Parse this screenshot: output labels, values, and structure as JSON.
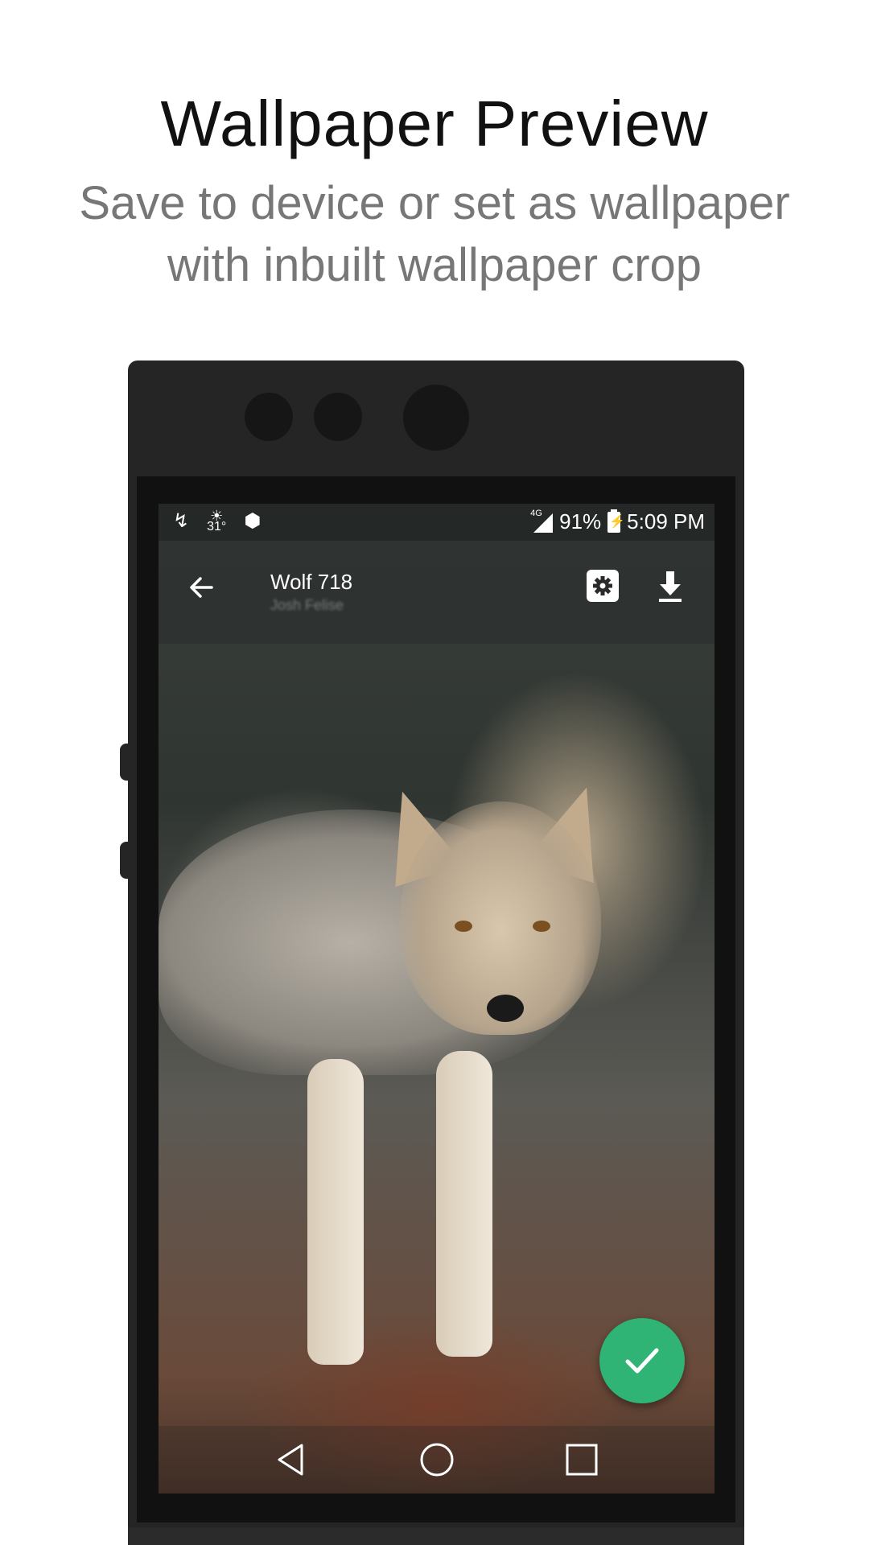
{
  "headline": "Wallpaper Preview",
  "subline": "Save to device or set as wallpaper with inbuilt wallpaper crop",
  "status_bar": {
    "temperature": "31°",
    "network": "4G",
    "battery": "91%",
    "time": "5:09 PM",
    "icons": [
      "usb-icon",
      "weather-icon",
      "android-debug-icon",
      "signal-icon",
      "battery-charging-icon"
    ]
  },
  "app_bar": {
    "title": "Wolf 718",
    "subtitle": "Josh Felise",
    "icons": [
      "back-arrow-icon",
      "settings-icon",
      "download-icon"
    ]
  },
  "fab": {
    "icon": "check-icon",
    "color": "#2fb476"
  },
  "nav_bar": {
    "icons": [
      "nav-back-icon",
      "nav-home-icon",
      "nav-recents-icon"
    ]
  },
  "colors": {
    "accent": "#2fb476",
    "device_frame": "#252525",
    "subline": "#777777"
  }
}
